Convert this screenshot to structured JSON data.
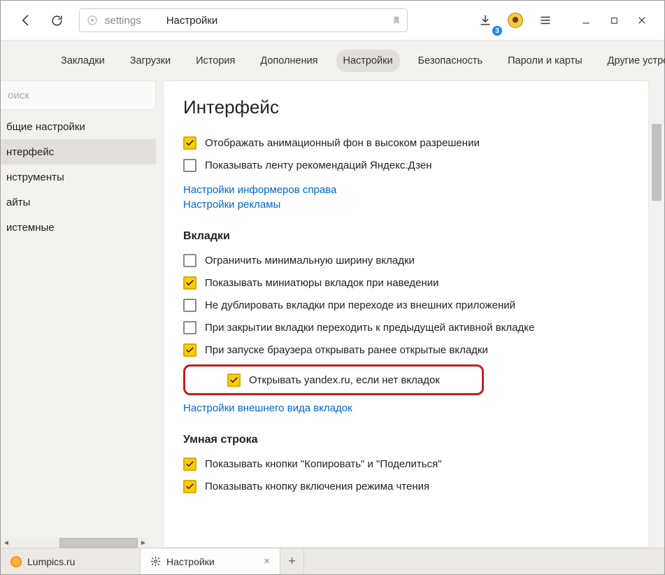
{
  "toolbar": {
    "omni_path": "settings",
    "omni_title": "Настройки",
    "download_badge": "3"
  },
  "nav": {
    "items": [
      {
        "label": "Закладки"
      },
      {
        "label": "Загрузки"
      },
      {
        "label": "История"
      },
      {
        "label": "Дополнения"
      },
      {
        "label": "Настройки",
        "active": true
      },
      {
        "label": "Безопасность"
      },
      {
        "label": "Пароли и карты"
      },
      {
        "label": "Другие устройства"
      }
    ]
  },
  "sidebar": {
    "search_placeholder": "оиск",
    "items": [
      {
        "label": "бщие настройки"
      },
      {
        "label": "нтерфейс",
        "active": true
      },
      {
        "label": "нструменты"
      },
      {
        "label": "айты"
      },
      {
        "label": "истемные"
      }
    ]
  },
  "panel": {
    "heading": "Интерфейс",
    "top_options": [
      {
        "checked": true,
        "label": "Отображать анимационный фон в высоком разрешении"
      },
      {
        "checked": false,
        "label": "Показывать ленту рекомендаций Яндекс.Дзен"
      }
    ],
    "top_links": [
      "Настройки информеров справа",
      "Настройки рекламы"
    ],
    "tabs_heading": "Вкладки",
    "tabs_options": [
      {
        "checked": false,
        "label": "Ограничить минимальную ширину вкладки"
      },
      {
        "checked": true,
        "label": "Показывать миниатюры вкладок при наведении"
      },
      {
        "checked": false,
        "label": "Не дублировать вкладки при переходе из внешних приложений"
      },
      {
        "checked": false,
        "label": "При закрытии вкладки переходить к предыдущей активной вкладке"
      },
      {
        "checked": true,
        "label": "При запуске браузера открывать ранее открытые вкладки"
      }
    ],
    "tabs_sub_option": {
      "checked": true,
      "label": "Открывать yandex.ru, если нет вкладок"
    },
    "tabs_link": "Настройки внешнего вида вкладок",
    "smart_heading": "Умная строка",
    "smart_options": [
      {
        "checked": true,
        "label": "Показывать кнопки \"Копировать\" и \"Поделиться\""
      },
      {
        "checked": true,
        "label": "Показывать кнопку включения режима чтения"
      }
    ]
  },
  "tabs": [
    {
      "label": "Lumpics.ru",
      "icon": "orange"
    },
    {
      "label": "Настройки",
      "icon": "gear",
      "active": true,
      "closeable": true
    }
  ]
}
